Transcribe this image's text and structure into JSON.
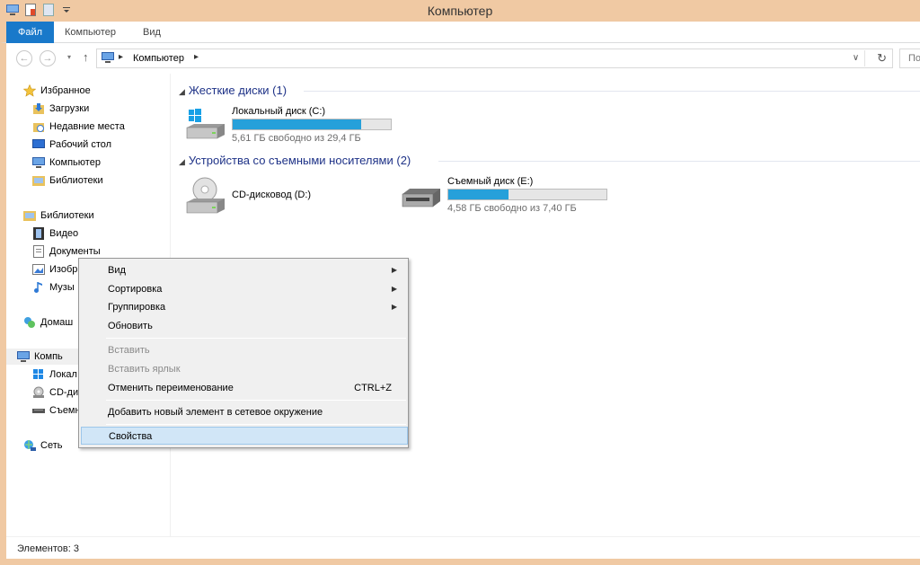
{
  "window": {
    "title": "Компьютер"
  },
  "ribbon": {
    "tabs": [
      "Файл",
      "Компьютер",
      "Вид"
    ]
  },
  "address": {
    "path": "Компьютер",
    "separator": "▸",
    "search_placeholder": "По"
  },
  "nav": {
    "favorites": {
      "label": "Избранное",
      "items": [
        "Загрузки",
        "Недавние места",
        "Рабочий стол",
        "Компьютер",
        "Библиотеки"
      ]
    },
    "libraries": {
      "label": "Библиотеки",
      "items": [
        "Видео",
        "Документы",
        "Изобр",
        "Музы"
      ]
    },
    "homegroup": "Домаш",
    "computer": {
      "label": "Компь",
      "items": [
        "Локал",
        "CD-ди",
        "Съемн"
      ]
    },
    "network": "Сеть"
  },
  "main": {
    "hard_disks": {
      "title": "Жесткие диски (1)",
      "drives": [
        {
          "name": "Локальный диск (C:)",
          "free": "5,61 ГБ свободно из 29,4 ГБ",
          "used_fraction": 0.81
        }
      ]
    },
    "removable": {
      "title": "Устройства со съемными носителями (2)",
      "cd_drive": {
        "name": "CD-дисковод (D:)"
      },
      "drive": {
        "name": "Съемный диск (E:)",
        "free": "4,58 ГБ свободно из 7,40 ГБ",
        "used_fraction": 0.38
      }
    }
  },
  "context_menu": {
    "items": [
      {
        "label": "Вид",
        "submenu": true
      },
      {
        "label": "Сортировка",
        "submenu": true
      },
      {
        "label": "Группировка",
        "submenu": true
      },
      {
        "label": "Обновить"
      },
      {
        "label": "Вставить",
        "disabled": true
      },
      {
        "label": "Вставить ярлык",
        "disabled": true
      },
      {
        "label": "Отменить переименование",
        "shortcut": "CTRL+Z"
      },
      {
        "label": "Добавить новый элемент в сетевое окружение"
      },
      {
        "label": "Свойства",
        "highlighted": true
      }
    ]
  },
  "status": {
    "items_count": "Элементов: 3"
  },
  "colors": {
    "accent": "#1979ca",
    "frame": "#f0c9a3",
    "progress": "#26a0da",
    "group_title": "#1e3287"
  }
}
